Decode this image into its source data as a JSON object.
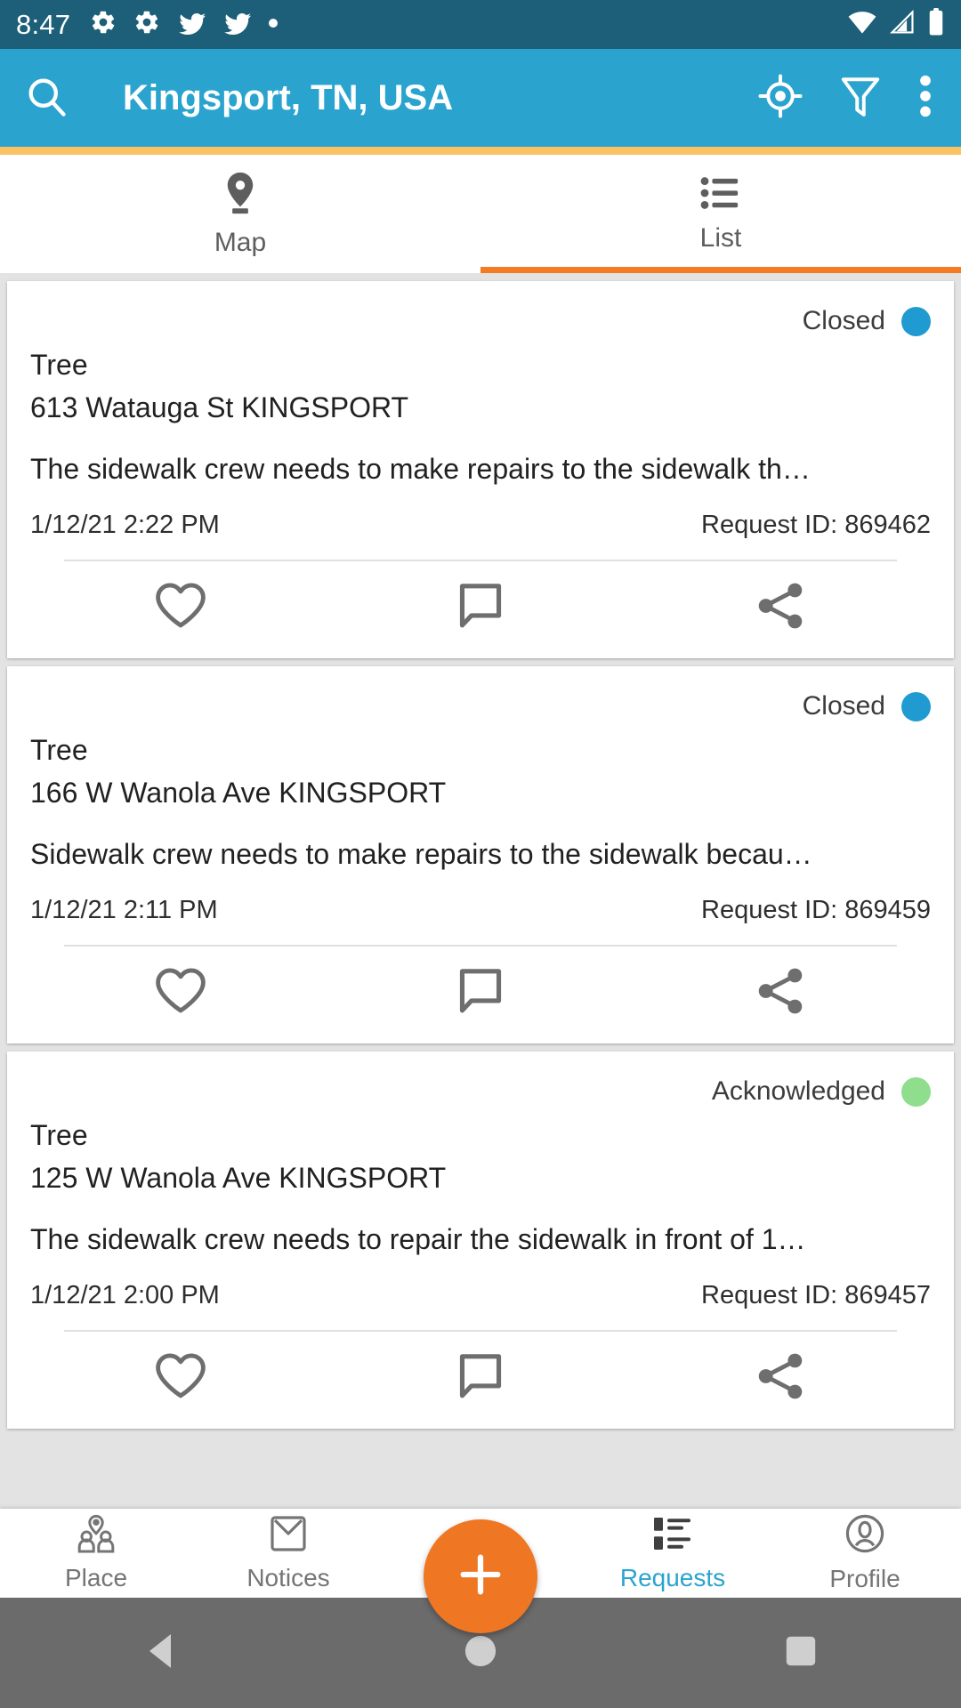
{
  "status_bar": {
    "time": "8:47",
    "left_icons": [
      "gear-icon",
      "gear-icon",
      "bird-icon",
      "bird-icon",
      "dot-icon"
    ],
    "right_icons": [
      "wifi-icon",
      "cell-signal-icon",
      "battery-icon"
    ],
    "background_color": "#1d5f78"
  },
  "app_bar": {
    "title": "Kingsport, TN, USA",
    "search_icon": "search-icon",
    "locate_icon": "gps-target-icon",
    "filter_icon": "filter-funnel-icon",
    "overflow_icon": "more-vertical-icon",
    "background_color": "#2aa4cf",
    "accent_strip_color": "#fbc264"
  },
  "tabs": {
    "active_index": 1,
    "indicator_color": "#f47b20",
    "items": [
      {
        "label": "Map",
        "icon": "map-pin-icon"
      },
      {
        "label": "List",
        "icon": "list-icon"
      }
    ]
  },
  "requests": [
    {
      "status": "Closed",
      "status_color": "#1f9bd1",
      "type": "Tree",
      "address": "613 Watauga St KINGSPORT",
      "description": "The sidewalk crew needs to make repairs to the sidewalk th…",
      "timestamp": "1/12/21 2:22 PM",
      "request_id": "Request ID: 869462",
      "actions": [
        "heart-icon",
        "comment-icon",
        "share-icon"
      ]
    },
    {
      "status": "Closed",
      "status_color": "#1f9bd1",
      "type": "Tree",
      "address": "166 W Wanola Ave KINGSPORT",
      "description": "Sidewalk crew needs to make repairs to the sidewalk becau…",
      "timestamp": "1/12/21 2:11 PM",
      "request_id": "Request ID: 869459",
      "actions": [
        "heart-icon",
        "comment-icon",
        "share-icon"
      ]
    },
    {
      "status": "Acknowledged",
      "status_color": "#8ede8e",
      "type": "Tree",
      "address": "125 W Wanola Ave KINGSPORT",
      "description": "The sidewalk crew needs to repair the sidewalk in front of 1…",
      "timestamp": "1/12/21 2:00 PM",
      "request_id": "Request ID: 869457",
      "actions": [
        "heart-icon",
        "comment-icon",
        "share-icon"
      ]
    }
  ],
  "bottom_nav": {
    "active_index": 3,
    "active_color": "#2aa4cf",
    "fab": {
      "icon": "plus-icon",
      "color": "#ef7622"
    },
    "items": [
      {
        "label": "Place",
        "icon": "place-people-icon"
      },
      {
        "label": "Notices",
        "icon": "envelope-icon"
      },
      {
        "label": "Requests",
        "icon": "request-list-icon"
      },
      {
        "label": "Profile",
        "icon": "person-circle-icon"
      }
    ]
  },
  "android_nav": {
    "background_color": "#6b6b6b",
    "buttons": [
      "back-icon",
      "home-icon",
      "recents-icon"
    ]
  }
}
